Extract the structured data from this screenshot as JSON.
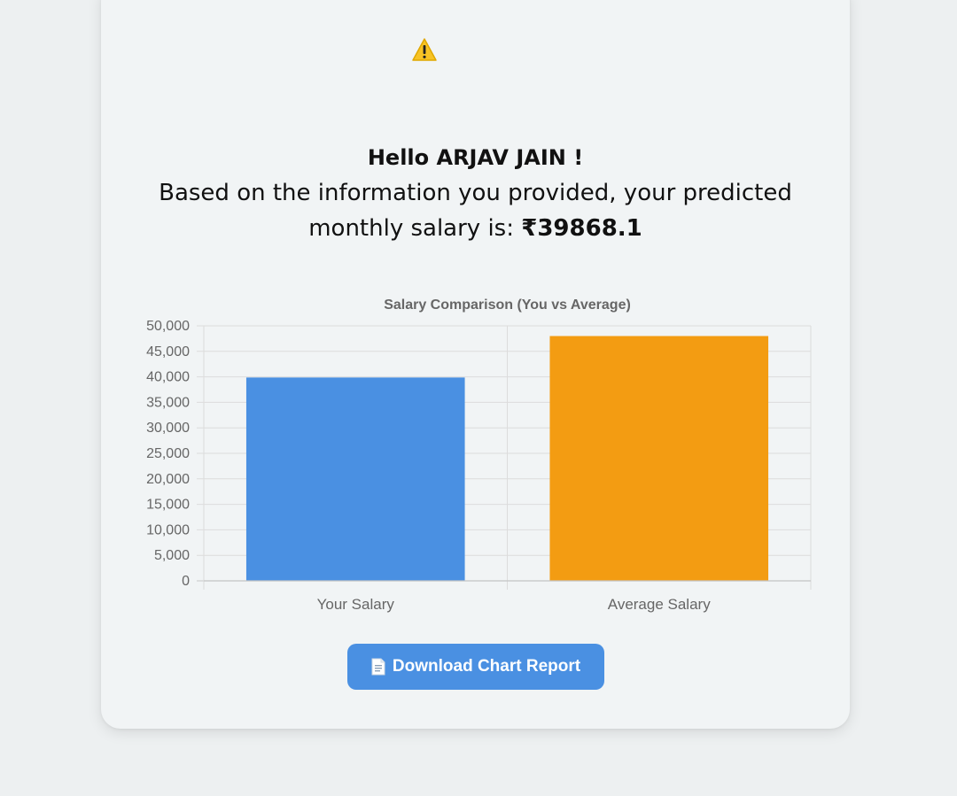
{
  "greeting": {
    "hello": "Hello ARJAV JAIN !",
    "line1": "Based on the information you provided, your predicted",
    "line2_prefix": "monthly salary is: ",
    "amount": "₹39868.1"
  },
  "icons": {
    "warning": "warning-icon",
    "document": "document-icon"
  },
  "button": {
    "download_label": "Download Chart Report"
  },
  "colors": {
    "your_salary_bar": "#4a90e2",
    "average_salary_bar": "#f39c12",
    "button_bg": "#4a90e2"
  },
  "chart_data": {
    "type": "bar",
    "title": "Salary Comparison (You vs Average)",
    "categories": [
      "Your Salary",
      "Average Salary"
    ],
    "values": [
      39868.1,
      48000
    ],
    "colors": [
      "#4a90e2",
      "#f39c12"
    ],
    "ylim": [
      0,
      50000
    ],
    "yticks": [
      0,
      5000,
      10000,
      15000,
      20000,
      25000,
      30000,
      35000,
      40000,
      45000,
      50000
    ],
    "ytick_labels": [
      "0",
      "5,000",
      "10,000",
      "15,000",
      "20,000",
      "25,000",
      "30,000",
      "35,000",
      "40,000",
      "45,000",
      "50,000"
    ],
    "grid": true,
    "legend": "none"
  }
}
